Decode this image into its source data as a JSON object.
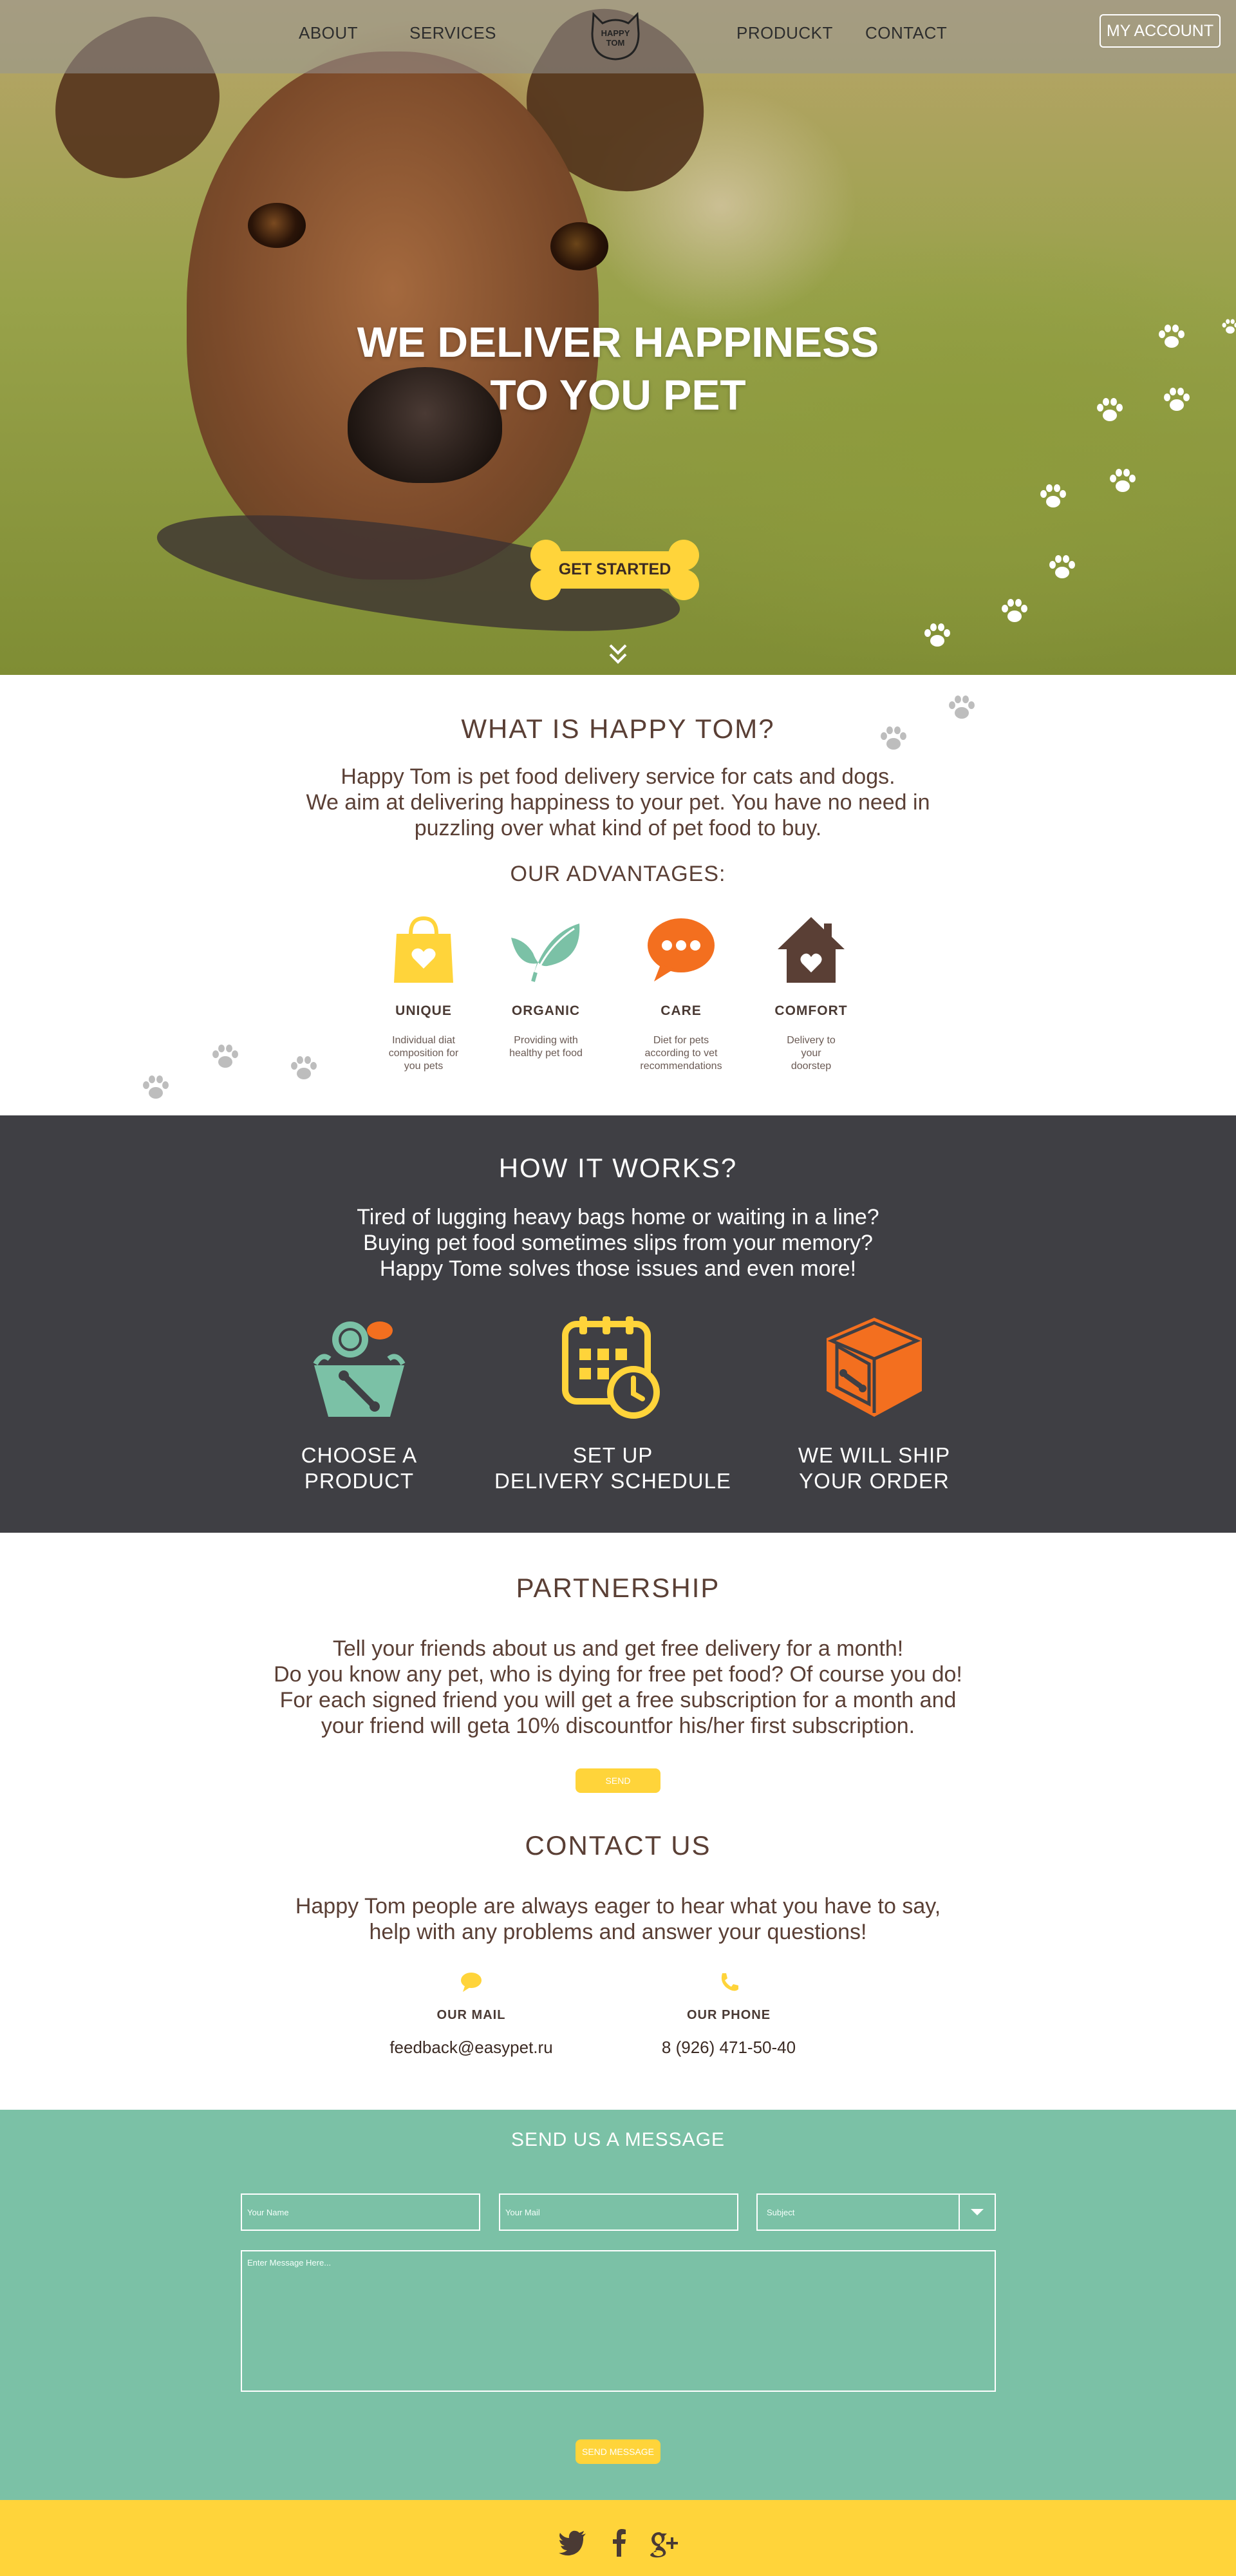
{
  "nav": {
    "about": "ABOUT",
    "services": "SERVICES",
    "logo_line1": "HAPPY",
    "logo_line2": "TOM",
    "product": "PRODUCKT",
    "contact": "CONTACT",
    "account": "MY ACCOUNT"
  },
  "hero": {
    "title_line1": "WE DELIVER HAPPINESS",
    "title_line2": "TO YOU PET",
    "cta": "GET STARTED"
  },
  "about": {
    "title": "WHAT IS HAPPY TOM?",
    "line1": "Happy Tom is pet food delivery service for cats and dogs.",
    "line2": "We aim at delivering happiness to your pet. You have no need in",
    "line3": "puzzling over what kind of pet food to buy.",
    "advantages_title": "OUR ADVANTAGES:",
    "advantages": [
      {
        "title": "UNIQUE",
        "desc": [
          "Individual diat",
          "composition for",
          "you pets"
        ],
        "icon": "shopping-bag-heart-icon"
      },
      {
        "title": "ORGANIC",
        "desc": [
          "Providing with",
          "healthy pet food"
        ],
        "icon": "leaf-icon"
      },
      {
        "title": "CARE",
        "desc": [
          "Diet for pets",
          "according to vet",
          "recommendations"
        ],
        "icon": "chat-bubble-icon"
      },
      {
        "title": "COMFORT",
        "desc": [
          "Delivery to",
          "your",
          "doorstep"
        ],
        "icon": "house-heart-icon"
      }
    ]
  },
  "how": {
    "title": "HOW IT WORKS?",
    "line1": "Tired of lugging heavy bags home or waiting in a line?",
    "line2": "Buying pet food sometimes slips from your memory?",
    "line3": "Happy Tome solves those issues and even more!",
    "steps": [
      {
        "line1": "CHOOSE A",
        "line2": "PRODUCT",
        "icon": "food-basket-icon"
      },
      {
        "line1": "SET UP",
        "line2": "DELIVERY SCHEDULE",
        "icon": "calendar-clock-icon"
      },
      {
        "line1": "WE WILL SHIP",
        "line2": "YOUR ORDER",
        "icon": "shipping-box-icon"
      }
    ]
  },
  "partnership": {
    "title": "PARTNERSHIP",
    "line1": "Tell your friends about us and get free delivery for a month!",
    "line2": "Do you know any pet, who is dying for free pet food? Of course you do!",
    "line3": "For each signed friend you will get a free subscription for a month and",
    "line4": "your friend will geta 10% discountfor his/her first subscription.",
    "button": "SEND"
  },
  "contact": {
    "title": "CONTACT US",
    "line1": "Happy Tom people are always eager to hear what you have to say,",
    "line2": "help with any problems and answer your questions!",
    "mail_label": "OUR MAIL",
    "mail_value": "feedback@easypet.ru",
    "phone_label": "OUR PHONE",
    "phone_value": "8 (926) 471-50-40"
  },
  "form": {
    "title": "SEND US A MESSAGE",
    "name_placeholder": "Your Name",
    "mail_placeholder": "Your Mail",
    "subject_placeholder": "Subject",
    "message_placeholder": "Enter Message Here...",
    "submit": "SEND MESSAGE"
  },
  "footer": {
    "social": [
      "twitter-icon",
      "facebook-icon",
      "google-plus-icon"
    ]
  },
  "colors": {
    "brand_brown": "#5a3f35",
    "accent_yellow": "#ffd43a",
    "mint": "#7bc1a6",
    "orange": "#f36f1f",
    "dark_section": "#3f3f44"
  }
}
